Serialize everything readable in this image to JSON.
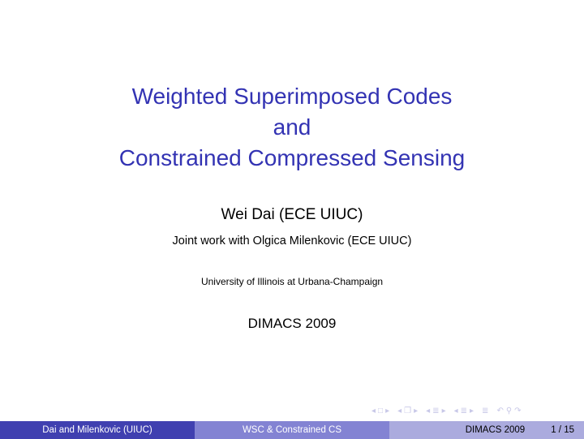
{
  "slide": {
    "title_lines": [
      "Weighted Superimposed Codes",
      "and",
      "Constrained Compressed Sensing"
    ],
    "author": "Wei Dai (ECE UIUC)",
    "joint": "Joint work with Olgica Milenkovic (ECE UIUC)",
    "institution": "University of Illinois at Urbana-Champaign",
    "date": "DIMACS 2009"
  },
  "nav": {
    "icons": [
      "arrow-left-icon",
      "frame-icon",
      "arrow-right-icon",
      "arrow-left-icon",
      "subsection-icon",
      "arrow-right-icon",
      "arrow-left-icon",
      "section-icon",
      "arrow-right-icon",
      "arrow-left-icon",
      "section-icon",
      "arrow-right-icon",
      "align-icon",
      "undo-icon",
      "search-icon",
      "redo-icon"
    ]
  },
  "footer": {
    "authors": "Dai and Milenkovic  (UIUC)",
    "short_title": "WSC & Constrained CS",
    "event": "DIMACS 2009",
    "page": "1 / 15"
  },
  "colors": {
    "title": "#3333B3",
    "footer_dark": "#4040B0",
    "footer_mid": "#8383D3",
    "footer_light": "#ABABDE"
  }
}
